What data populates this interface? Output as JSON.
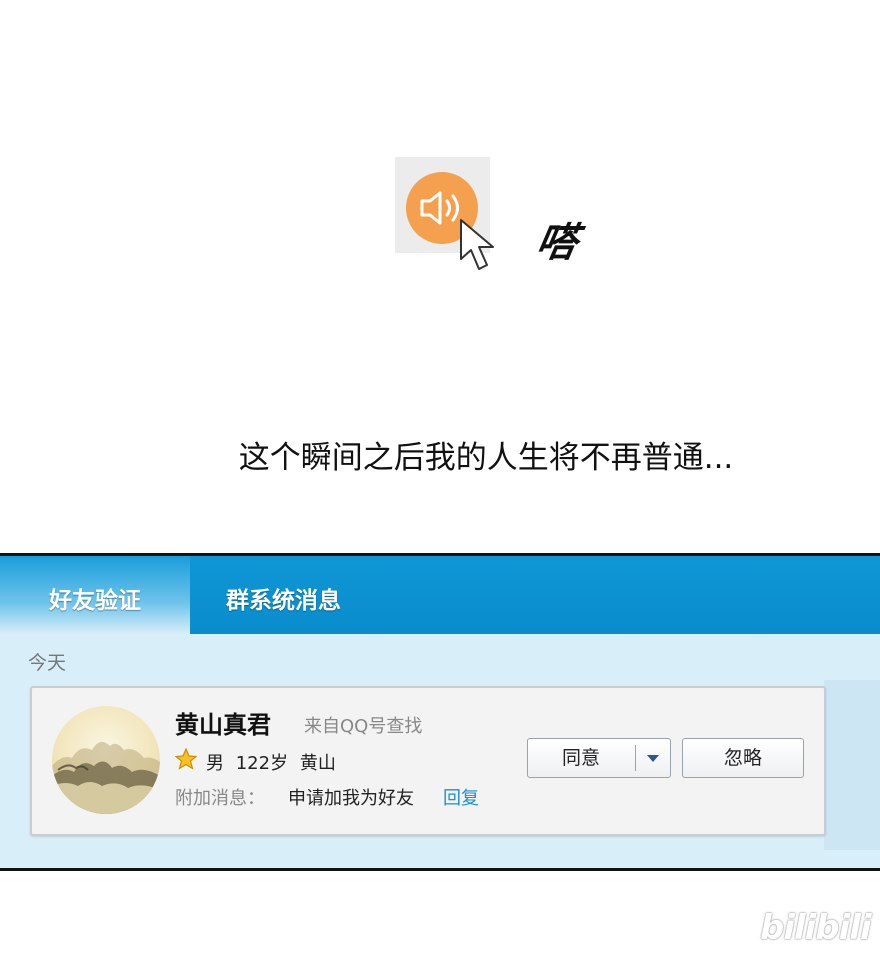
{
  "comic": {
    "sound_effect": "嗒",
    "caption": "这个瞬间之后我的人生将不再普通..."
  },
  "icons": {
    "speaker": "speaker-volume-icon",
    "cursor": "mouse-pointer-icon",
    "star": "star-level-icon",
    "dropdown": "chevron-down-icon"
  },
  "colors": {
    "speaker_accent": "#f5a04e",
    "tabbar": "#0f97d6",
    "panel_bg": "#d8eef9",
    "link": "#1a8fd6"
  },
  "tabs": [
    {
      "label": "好友验证",
      "active": true
    },
    {
      "label": "群系统消息",
      "active": false
    }
  ],
  "date_group": "今天",
  "request": {
    "name": "黄山真君",
    "source": "来自QQ号查找",
    "gender": "男",
    "age": "122岁",
    "location": "黄山",
    "message_label": "附加消息：",
    "message": "申请加我为好友",
    "reply_link": "回复"
  },
  "actions": {
    "agree": "同意",
    "ignore": "忽略"
  },
  "watermark": "bilibili"
}
